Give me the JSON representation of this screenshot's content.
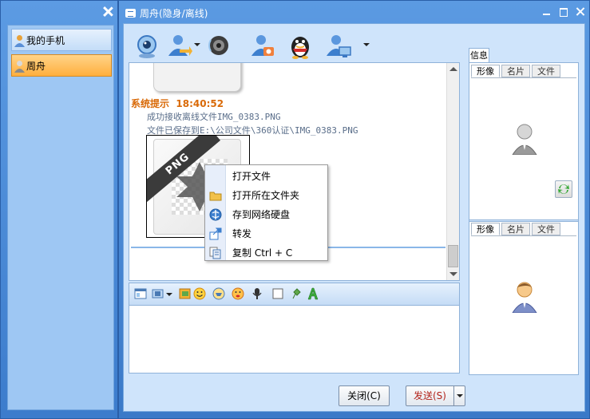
{
  "sidebar": {
    "contacts": [
      {
        "label": "我的手机"
      },
      {
        "label": "周舟"
      }
    ]
  },
  "window": {
    "title": "周舟(隐身/离线)"
  },
  "toolbar": {
    "icons": [
      "video-chat-icon",
      "transfer-file-icon",
      "voice-chat-icon",
      "remote-assist-icon",
      "qq-icon",
      "desktop-share-icon"
    ]
  },
  "messages": {
    "system_title": "系统提示",
    "time": "18:40:52",
    "line1": "成功接收离线文件IMG_0383.PNG",
    "line2": "文件已保存到E:\\公司文件\\360认证\\IMG_0383.PNG",
    "file_type_label": "PNG"
  },
  "context_menu": {
    "items": [
      {
        "label": "打开文件"
      },
      {
        "label": "打开所在文件夹"
      },
      {
        "label": "存到网络硬盘"
      },
      {
        "label": "转发"
      },
      {
        "label": "复制 Ctrl + C"
      }
    ]
  },
  "buttons": {
    "close": "关闭(C)",
    "send": "发送(S)"
  },
  "info": {
    "tab": "信息",
    "section1_tabs": [
      "形像",
      "名片",
      "文件"
    ],
    "section2_tabs": [
      "形像",
      "名片",
      "文件"
    ]
  },
  "colors": {
    "title_blue": "#3d7fce",
    "selected_contact": "#ffaf3e",
    "system_text": "#d96a08",
    "send_text": "#b3241b"
  }
}
